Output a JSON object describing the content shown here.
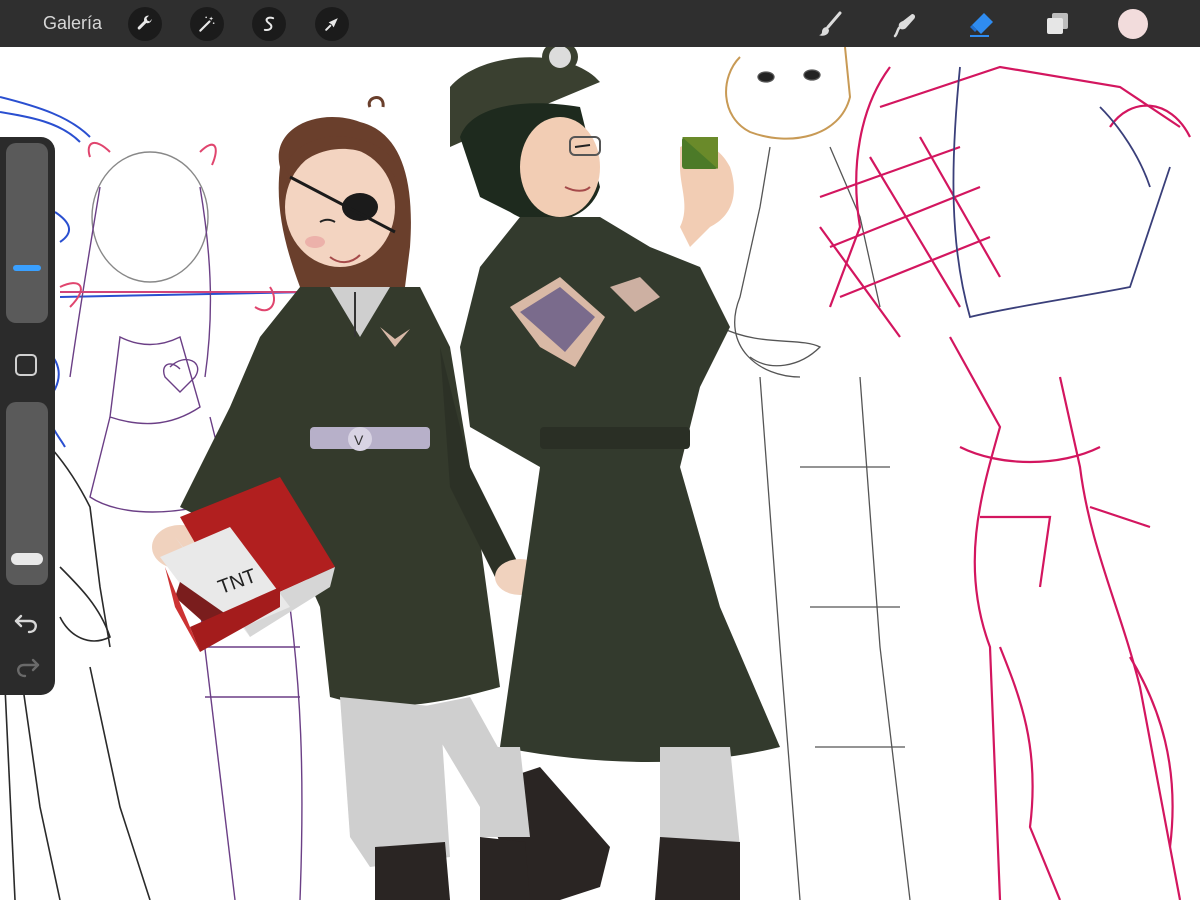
{
  "topbar": {
    "gallery_label": "Galería",
    "actions": [
      "wrench-icon",
      "magic-wand-icon",
      "selection-icon",
      "transform-arrow-icon"
    ],
    "tools": [
      "brush-icon",
      "smudge-icon",
      "eraser-icon",
      "layers-icon"
    ],
    "active_tool": "eraser-icon",
    "current_color": "#f2dcdc",
    "accent_color": "#2f8cf0"
  },
  "sidebar": {
    "size_slider_value": 0.3,
    "opacity_slider_value": 0.05,
    "items": [
      "brush-size-slider",
      "modify-button",
      "opacity-slider",
      "undo-icon",
      "redo-icon"
    ]
  },
  "canvas": {
    "tnt_label": "TNT",
    "belt_buckle_letter": "V"
  }
}
